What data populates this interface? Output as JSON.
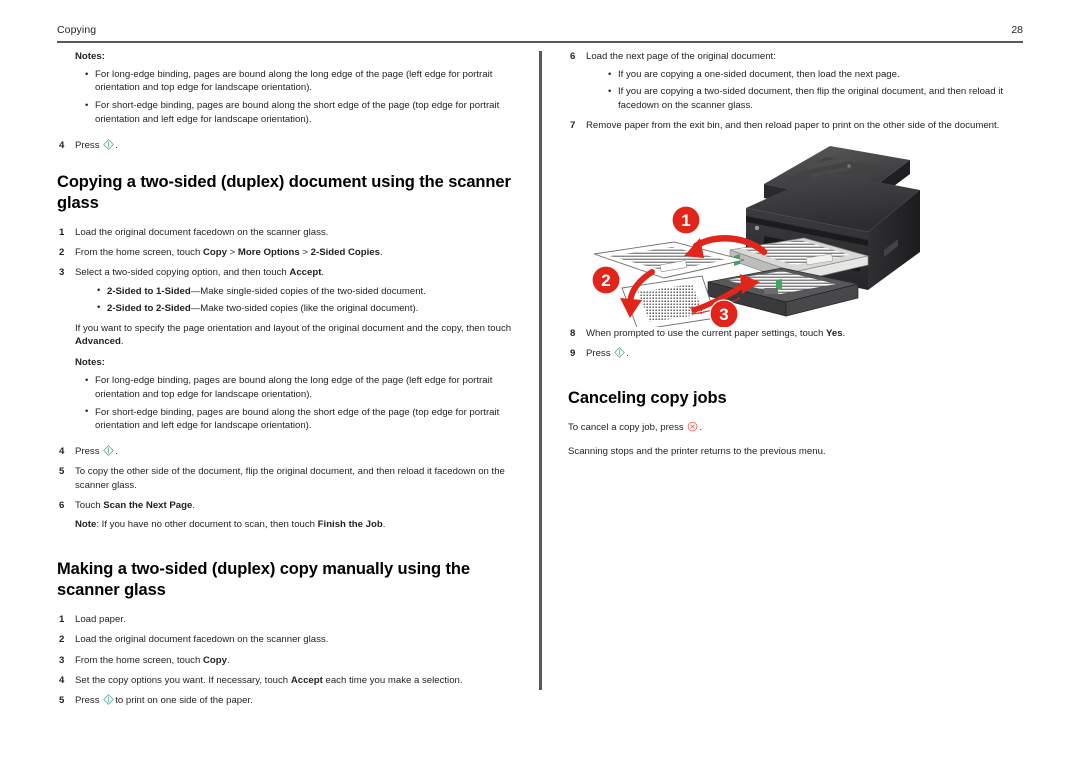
{
  "header": {
    "title": "Copying",
    "page_number": "28"
  },
  "icons": {
    "start_button": "start-button-icon",
    "cancel_button": "cancel-button-icon",
    "start_color": "#5aa79b",
    "cancel_color": "#e8564a"
  },
  "left_column": {
    "notes_label_top": "Notes:",
    "notes_top": [
      "For long-edge binding, pages are bound along the long edge of the page (left edge for portrait orientation and top edge for landscape orientation).",
      "For short-edge binding, pages are bound along the short edge of the page (top edge for portrait orientation and left edge for landscape orientation)."
    ],
    "step4_top": {
      "num": "4",
      "text_before": "Press",
      "text_after": "."
    },
    "section1": {
      "heading": "Copying a two-sided (duplex) document using the scanner glass",
      "steps": [
        {
          "num": "1",
          "html": "Load the original document facedown on the scanner glass."
        },
        {
          "num": "2",
          "html": "From the home screen, touch <b>Copy</b> > <b>More Options</b> > <b>2-Sided Copies</b>."
        },
        {
          "num": "3",
          "html": "Select a two-sided copying option, and then touch <b>Accept</b>."
        }
      ],
      "step3_bullets": [
        "<b>2-Sided to 1-Sided</b>—Make single-sided copies of the two-sided document.",
        "<b>2-Sided to 2-Sided</b>—Make two-sided copies (like the original document)."
      ],
      "step3_para": "If you want to specify the page orientation and layout of the original document and the copy, then touch <b>Advanced</b>.",
      "notes_label": "Notes:",
      "notes": [
        "For long-edge binding, pages are bound along the long edge of the page (left edge for portrait orientation and top edge for landscape orientation).",
        "For short-edge binding, pages are bound along the short edge of the page (top edge for portrait orientation and left edge for landscape orientation)."
      ],
      "step4": {
        "num": "4",
        "text_before": "Press",
        "text_after": "."
      },
      "step5": {
        "num": "5",
        "html": "To copy the other side of the document, flip the original document, and then reload it facedown on the scanner glass."
      },
      "step6": {
        "num": "6",
        "html": "Touch <b>Scan the Next Page</b>."
      },
      "step6_note": "<b>Note</b>: If you have no other document to scan, then touch <b>Finish the Job</b>."
    },
    "section2": {
      "heading": "Making a two-sided (duplex) copy manually using the scanner glass",
      "steps": [
        {
          "num": "1",
          "html": "Load paper."
        },
        {
          "num": "2",
          "html": "Load the original document facedown on the scanner glass."
        },
        {
          "num": "3",
          "html": "From the home screen, touch <b>Copy</b>."
        },
        {
          "num": "4",
          "html": "Set the copy options you want. If necessary, touch <b>Accept</b> each time you make a selection."
        }
      ],
      "step5": {
        "num": "5",
        "text_before": "Press",
        "text_after": "to print on one side of the paper."
      }
    }
  },
  "right_column": {
    "step6": {
      "num": "6",
      "html": "Load the next page of the original document:"
    },
    "step6_bullets": [
      "If you are copying a one-sided document, then load the next page.",
      "If you are copying a two-sided document, then flip the original document, and then reload it facedown on the scanner glass."
    ],
    "step7": {
      "num": "7",
      "html": "Remove paper from the exit bin, and then reload paper to print on the other side of the document."
    },
    "figure": {
      "name": "printer-duplex-illustration",
      "callouts": [
        "1",
        "2",
        "3"
      ],
      "callout_color": "#e1251b"
    },
    "step8": {
      "num": "8",
      "html": "When prompted to use the current paper settings, touch <b>Yes</b>."
    },
    "step9": {
      "num": "9",
      "text_before": "Press",
      "text_after": "."
    },
    "section": {
      "heading": "Canceling copy jobs",
      "para1_before": "To cancel a copy job, press",
      "para1_after": ".",
      "para2": "Scanning stops and the printer returns to the previous menu."
    }
  }
}
